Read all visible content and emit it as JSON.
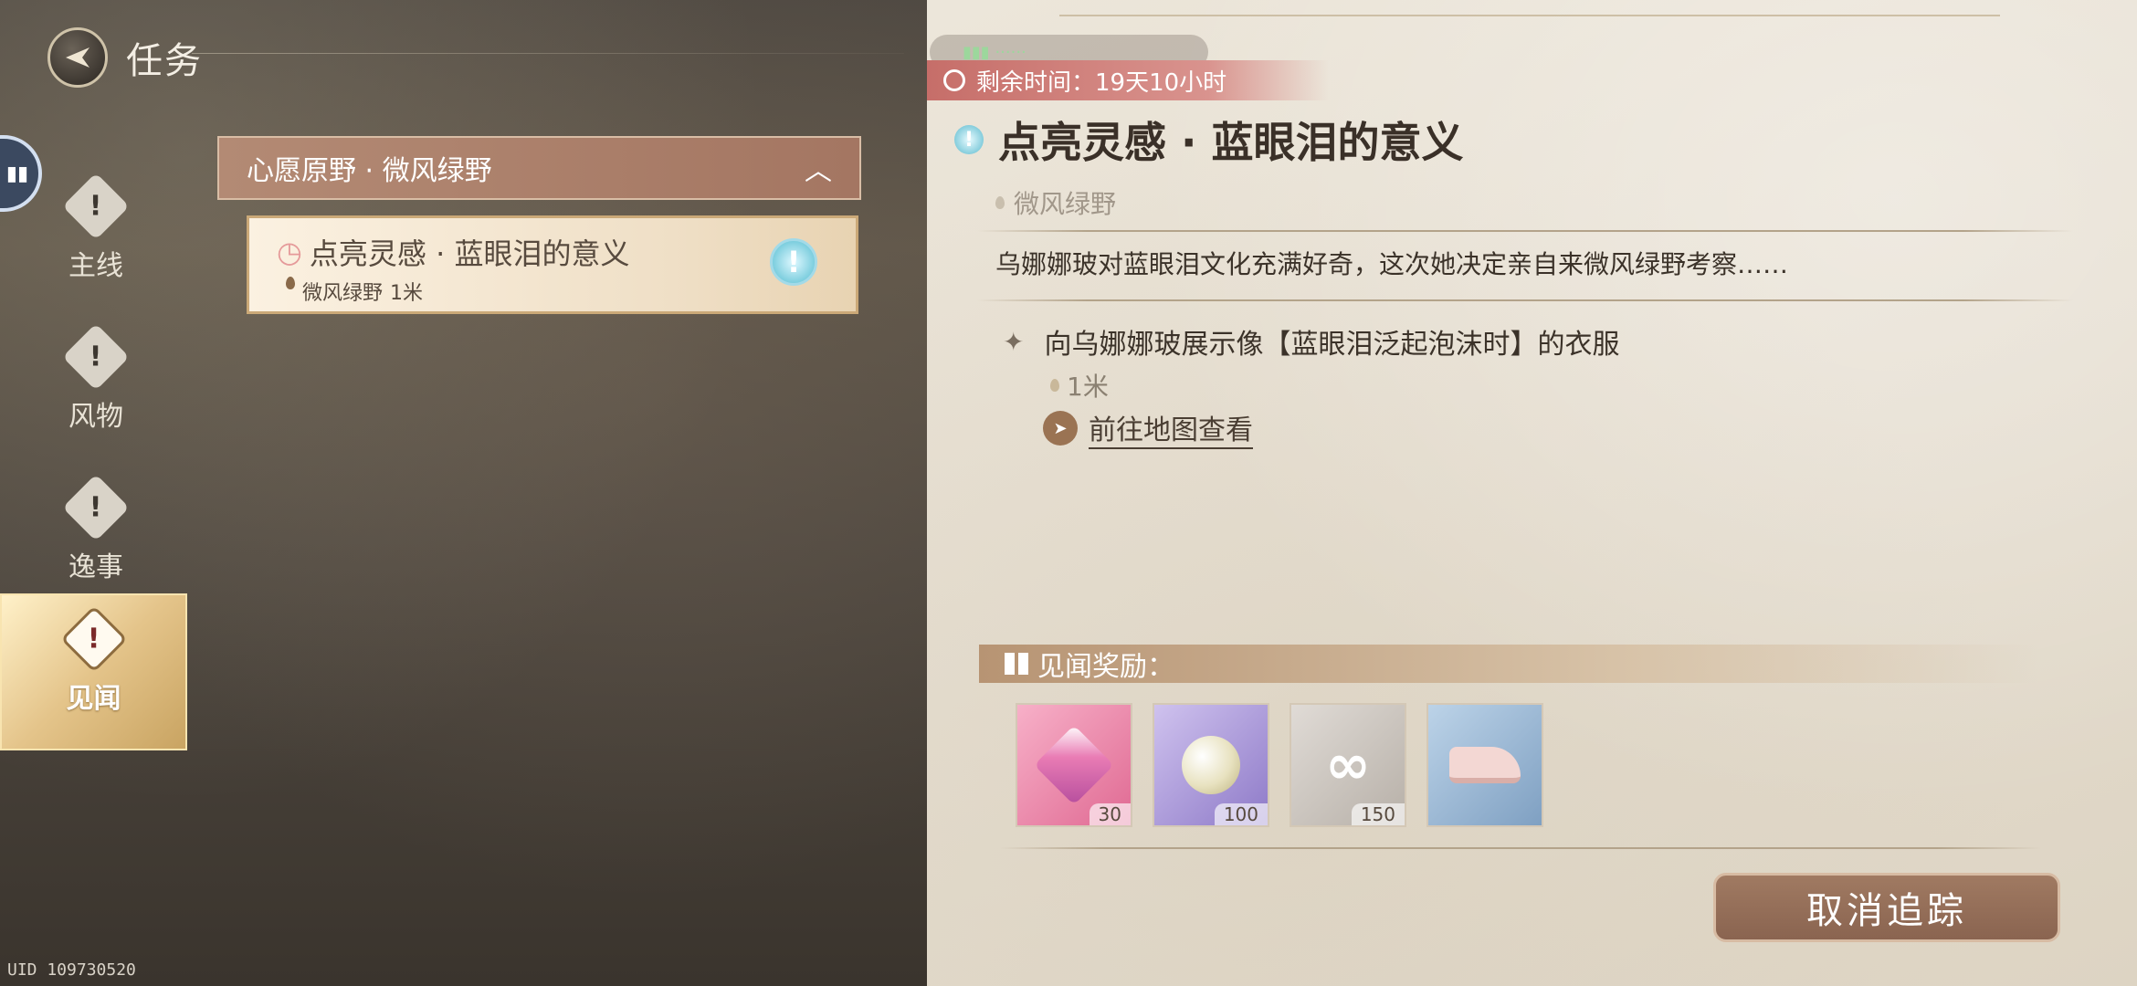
{
  "header": {
    "title": "任务"
  },
  "sidebar": {
    "bubble_label": "▮▮",
    "tabs": [
      {
        "label": "主线",
        "icon": "exclamation-diamond-icon",
        "active": false
      },
      {
        "label": "风物",
        "icon": "exclamation-diamond-icon",
        "active": false
      },
      {
        "label": "逸事",
        "icon": "exclamation-diamond-icon",
        "active": false
      },
      {
        "label": "见闻",
        "icon": "exclamation-diamond-icon",
        "active": true
      }
    ]
  },
  "quest_list": {
    "region": "心愿原野 · 微风绿野",
    "quest": {
      "title": "点亮灵感 · 蓝眼泪的意义",
      "location": "微风绿野",
      "distance": "1米"
    }
  },
  "detail": {
    "timer": "剩余时间：19天10小时",
    "title": "点亮灵感 · 蓝眼泪的意义",
    "location": "微风绿野",
    "description": "乌娜娜玻对蓝眼泪文化充满好奇，这次她决定亲自来微风绿野考察……",
    "objective": "向乌娜娜玻展示像【蓝眼泪泛起泡沫时】的衣服",
    "objective_distance": "1米",
    "map_link": "前往地图查看",
    "rewards_title": "见闻奖励：",
    "rewards": [
      {
        "icon": "pink-gem-icon",
        "count": "30"
      },
      {
        "icon": "pearl-icon",
        "count": "100"
      },
      {
        "icon": "silver-bow-icon",
        "count": "150"
      },
      {
        "icon": "shoes-icon",
        "count": ""
      }
    ],
    "cancel_button": "取消追踪"
  },
  "footer": {
    "uid": "UID 109730520"
  },
  "colors": {
    "accent_gold": "#e4c48a",
    "region_header": "#a47662",
    "timer_red": "#c66e69"
  }
}
